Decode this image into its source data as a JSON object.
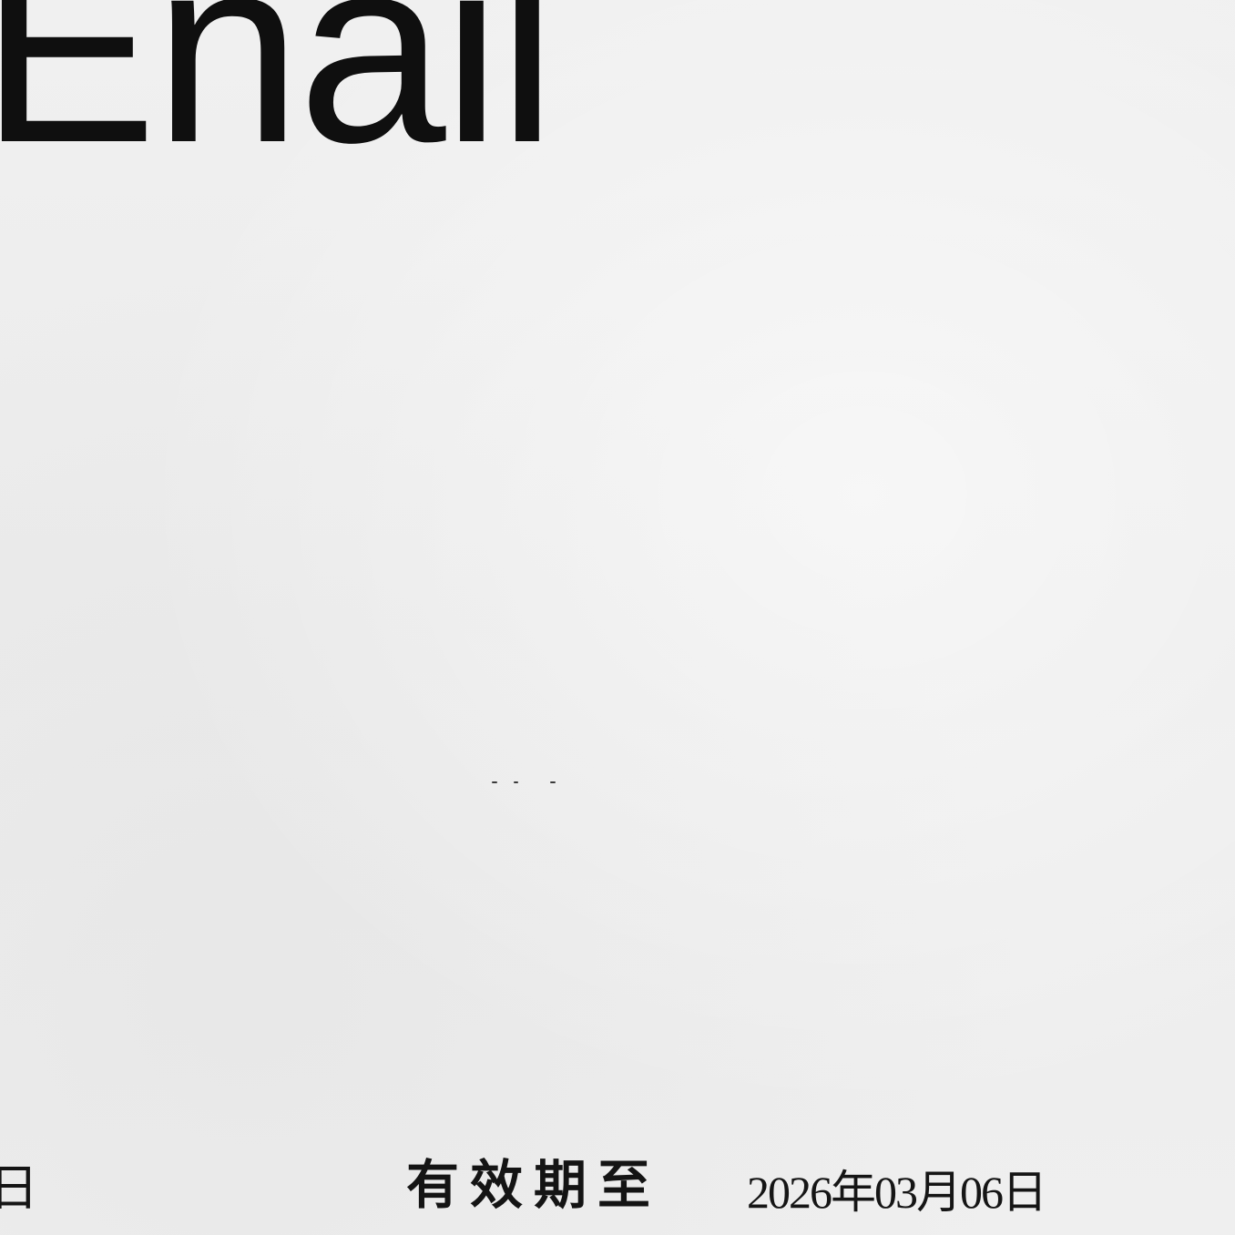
{
  "document": {
    "heading": "Enail",
    "left_edge_fragment": "日",
    "validity": {
      "label": "有效期至",
      "date": "2026年03月06日"
    }
  },
  "colors": {
    "paper": "#eeeeee",
    "ink": "#111111"
  }
}
